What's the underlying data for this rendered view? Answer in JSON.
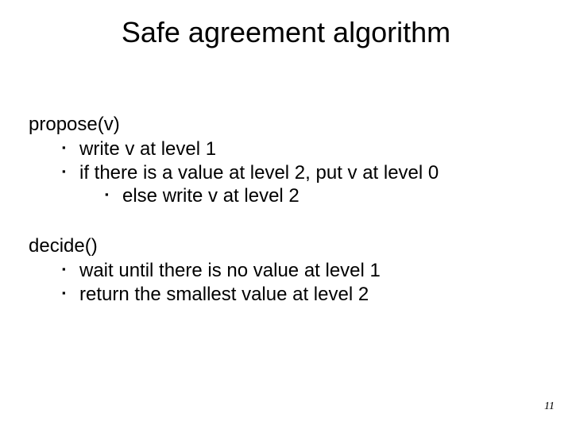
{
  "title": "Safe agreement algorithm",
  "propose": {
    "header": "propose(v)",
    "items": [
      "write v at level 1",
      "if there is a value at level 2, put v at level 0"
    ],
    "sub": "else write v at level 2"
  },
  "decide": {
    "header": "decide()",
    "items": [
      "wait until there is no value at level 1",
      "return the smallest value at level 2"
    ]
  },
  "page_number": "11"
}
